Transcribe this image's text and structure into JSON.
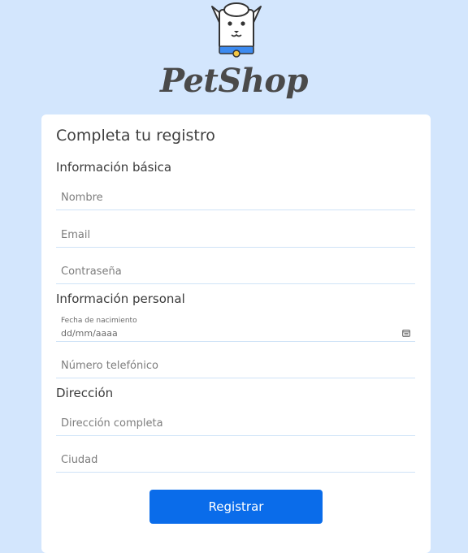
{
  "header": {
    "brand": "PetShop",
    "logo_icon": "dog-head-logo-icon"
  },
  "form": {
    "title": "Completa tu registro",
    "sections": {
      "basic": "Información básica",
      "personal": "Información personal",
      "address": "Dirección"
    },
    "fields": {
      "nombre": {
        "placeholder": "Nombre",
        "value": ""
      },
      "email": {
        "placeholder": "Email",
        "value": ""
      },
      "password": {
        "placeholder": "Contraseña",
        "value": ""
      },
      "birthdate": {
        "label": "Fecha de nacimiento",
        "placeholder": "dd/mm/aaaa",
        "icon": "calendar-icon"
      },
      "phone": {
        "placeholder": "Número telefónico",
        "value": ""
      },
      "address": {
        "placeholder": "Dirección completa",
        "value": ""
      },
      "city": {
        "placeholder": "Ciudad",
        "value": ""
      }
    },
    "submit_label": "Registrar"
  },
  "colors": {
    "background": "#d3e6fd",
    "card": "#ffffff",
    "primary": "#0a6cea",
    "field_underline": "#cfe3f7",
    "brand_text": "#4a4a4a"
  }
}
